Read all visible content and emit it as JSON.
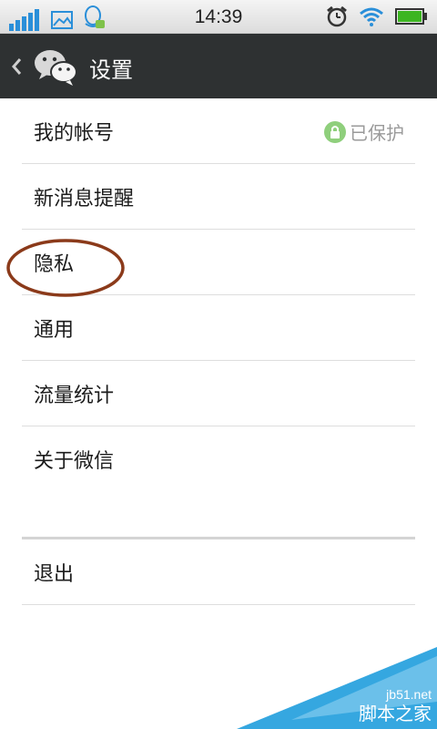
{
  "status_bar": {
    "time": "14:39",
    "icons": [
      "signal-icon",
      "image-icon",
      "qq-icon",
      "alarm-icon",
      "wifi-icon",
      "battery-icon"
    ]
  },
  "title_bar": {
    "title": "设置",
    "back_icon": "chevron-left-icon",
    "logo_icon": "wechat-logo-icon"
  },
  "settings": {
    "items": [
      {
        "label": "我的帐号",
        "status": "已保护"
      },
      {
        "label": "新消息提醒"
      },
      {
        "label": "隐私"
      },
      {
        "label": "通用"
      },
      {
        "label": "流量统计"
      },
      {
        "label": "关于微信"
      }
    ],
    "logout_label": "退出"
  },
  "colors": {
    "title_bar_bg": "#2e3132",
    "annotation_circle": "#8b3a1a",
    "lock_badge": "#8fcf7c",
    "watermark": "#35a7e0"
  },
  "watermark": {
    "line1": "jb51.net",
    "line2": "脚本之家"
  }
}
